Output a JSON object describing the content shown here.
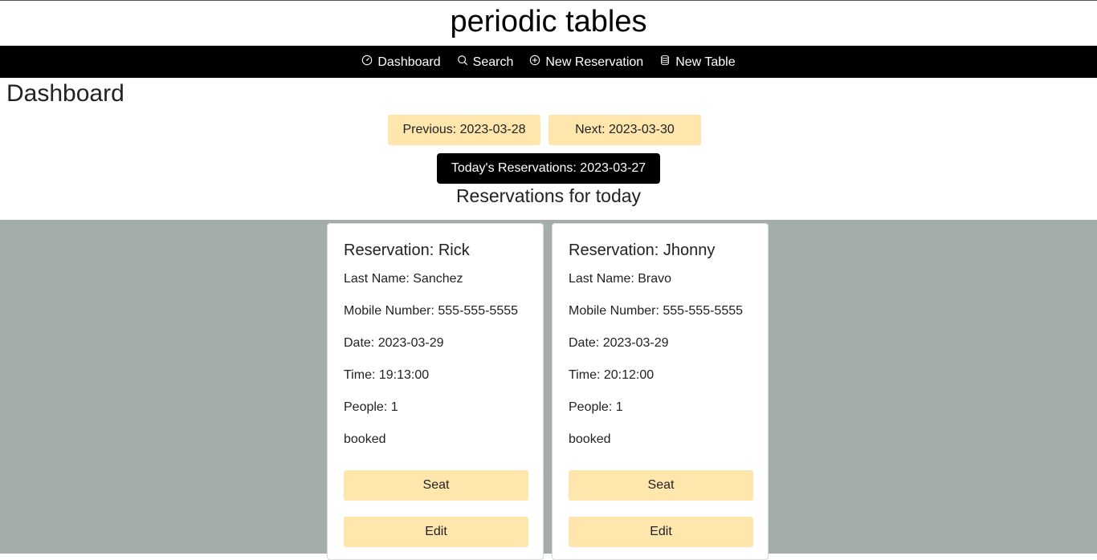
{
  "app": {
    "title": "periodic tables"
  },
  "nav": {
    "items": [
      {
        "label": "Dashboard",
        "icon": "dashboard-icon"
      },
      {
        "label": "Search",
        "icon": "search-icon"
      },
      {
        "label": "New Reservation",
        "icon": "plus-circle-icon"
      },
      {
        "label": "New Table",
        "icon": "database-icon"
      }
    ]
  },
  "page": {
    "title": "Dashboard"
  },
  "date_nav": {
    "previous_label": "Previous: 2023-03-28",
    "next_label": "Next: 2023-03-30",
    "today_label": "Today's Reservations: 2023-03-27"
  },
  "section": {
    "heading": "Reservations for today"
  },
  "reservations": [
    {
      "title": "Reservation: Rick",
      "last_name": "Last Name: Sanchez",
      "mobile": "Mobile Number: 555-555-5555",
      "date": "Date: 2023-03-29",
      "time": "Time: 19:13:00",
      "people": "People: 1",
      "status": "booked",
      "seat_label": "Seat",
      "edit_label": "Edit"
    },
    {
      "title": "Reservation: Jhonny",
      "last_name": "Last Name: Bravo",
      "mobile": "Mobile Number: 555-555-5555",
      "date": "Date: 2023-03-29",
      "time": "Time: 20:12:00",
      "people": "People: 1",
      "status": "booked",
      "seat_label": "Seat",
      "edit_label": "Edit"
    }
  ],
  "colors": {
    "navbar": "#000000",
    "button_accent": "#fee6ac",
    "gray_background": "#a2adac"
  }
}
